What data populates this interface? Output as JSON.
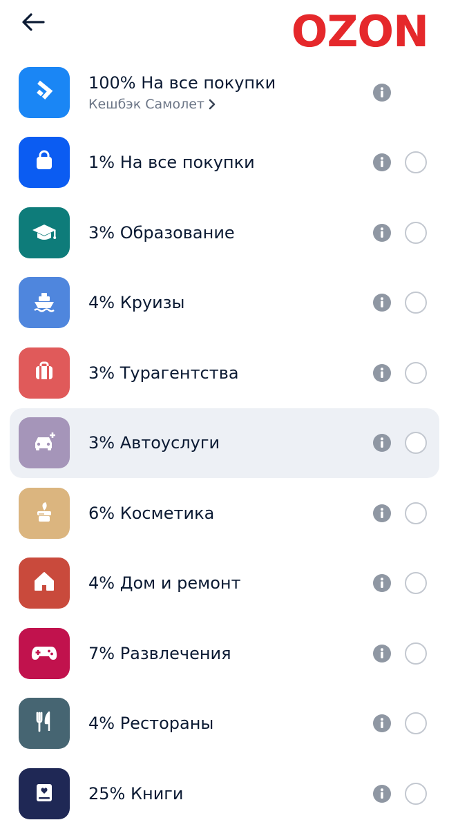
{
  "header": {
    "logo_text": "OZON",
    "logo_color": "#e5282b"
  },
  "items": [
    {
      "title": "100% На все покупки",
      "subtitle": "Кешбэк Самолет",
      "icon": "samolet-logo-icon",
      "color": "#1a86f5",
      "has_radio": false,
      "highlighted": false
    },
    {
      "title": "1% На все покупки",
      "icon": "shopping-bag-icon",
      "color": "#0b5cf2",
      "has_radio": true,
      "highlighted": false
    },
    {
      "title": "3% Образование",
      "icon": "graduation-cap-icon",
      "color": "#0e7c7a",
      "has_radio": true,
      "highlighted": false
    },
    {
      "title": "4% Круизы",
      "icon": "ship-icon",
      "color": "#4f86dd",
      "has_radio": true,
      "highlighted": false
    },
    {
      "title": "3% Турагентства",
      "icon": "suitcase-icon",
      "color": "#e05a5a",
      "has_radio": true,
      "highlighted": false
    },
    {
      "title": "3% Автоуслуги",
      "icon": "car-plus-icon",
      "color": "#a595b9",
      "has_radio": true,
      "highlighted": true
    },
    {
      "title": "6% Косметика",
      "icon": "cosmetics-jar-icon",
      "color": "#dbb57f",
      "has_radio": true,
      "highlighted": false
    },
    {
      "title": "4% Дом и ремонт",
      "icon": "house-icon",
      "color": "#c94a3c",
      "has_radio": true,
      "highlighted": false
    },
    {
      "title": "7% Развлечения",
      "icon": "gamepad-icon",
      "color": "#c1124d",
      "has_radio": true,
      "highlighted": false
    },
    {
      "title": "4% Рестораны",
      "icon": "fork-knife-icon",
      "color": "#466572",
      "has_radio": true,
      "highlighted": false
    },
    {
      "title": "25% Книги",
      "icon": "book-icon",
      "color": "#1f2855",
      "has_radio": true,
      "highlighted": false
    }
  ]
}
